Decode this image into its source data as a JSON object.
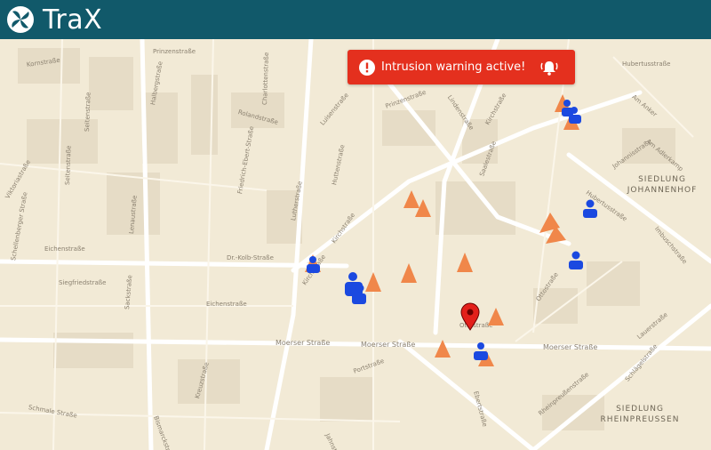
{
  "app": {
    "name": "TraX"
  },
  "alert": {
    "text": "Intrusion warning active!",
    "icon": "warning-icon",
    "action_icon": "bell-icon"
  },
  "colors": {
    "header": "#11596a",
    "alert": "#e4301e",
    "person": "#1b49e0",
    "cone": "#f0874a",
    "pin": "#e3201b",
    "map_bg": "#f2ead6"
  },
  "map": {
    "streets": [
      "Prinzenstraße",
      "Kornstraße",
      "Viktoriastraße",
      "Seitenstraße",
      "Seitenstraße",
      "Halbergstraße",
      "Charlottenstraße",
      "Rolandstraße",
      "Friedrich-Ebert-Straße",
      "Luisenstraße",
      "Lutherstraße",
      "Huttenstraße",
      "Prinzenstraße",
      "Lindenstraße",
      "Kirchstraße",
      "Kirchstraße",
      "Saalestraße",
      "Hubertusstraße",
      "Am Anker",
      "Am Adlerkamp",
      "Johannisstraße",
      "Hubertusstraße",
      "Imbuschstraße",
      "Schellenberger Straße",
      "Eichenstraße",
      "Siegfriedstraße",
      "Lenaustraße",
      "Sackstraße",
      "Dr.-Kolb-Straße",
      "Kirchstraße",
      "Eichenstraße",
      "Moerser Straße",
      "Moerser Straße",
      "Moerser Straße",
      "Ottostraße",
      "Ottostraße",
      "Portstraße",
      "Lauerstraße",
      "Rheinpreußenstraße",
      "Ebertstraße",
      "Schmale Straße",
      "Bismarckstraße",
      "Kreuzstraße",
      "Jahnstraße",
      "Schlägelstraße"
    ],
    "districts": [
      {
        "line1": "SIEDLUNG",
        "line2": "JOHANNENHOF"
      },
      {
        "line1": "SIEDLUNG",
        "line2": "RHEINPREUSSEN"
      }
    ]
  }
}
